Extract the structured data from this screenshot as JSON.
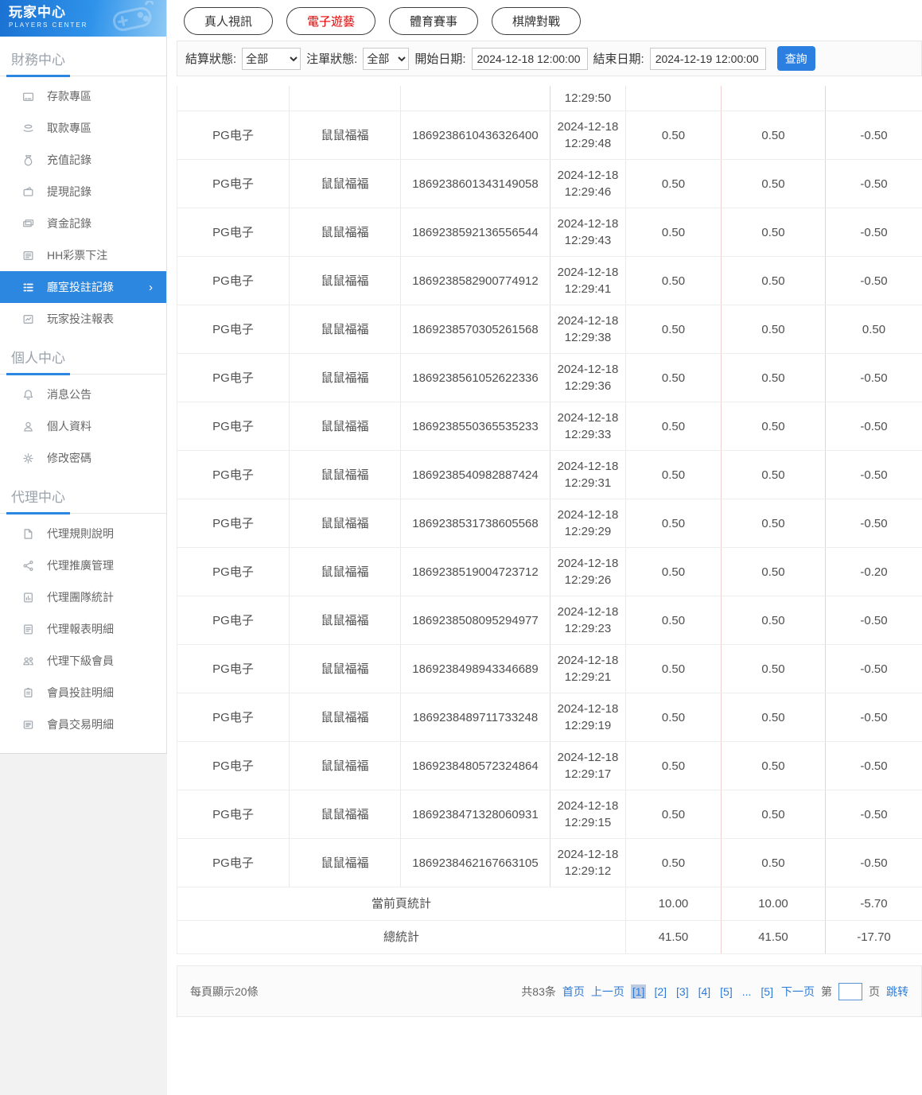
{
  "colors": {
    "sidebar_active_blue": "#2b87e0",
    "tab_active_red": "#e60000",
    "link_blue": "#2e7bd6",
    "search_button_blue": "#2b7fe0"
  },
  "sidebar": {
    "header": {
      "title": "玩家中心",
      "subtitle": "PLAYERS CENTER"
    },
    "sections": [
      {
        "title": "財務中心",
        "items": [
          {
            "icon": "deposit-card-icon",
            "label": "存款專區"
          },
          {
            "icon": "withdraw-hand-icon",
            "label": "取款專區"
          },
          {
            "icon": "recharge-record-icon",
            "label": "充值記錄"
          },
          {
            "icon": "withdrawal-record-icon",
            "label": "提現記錄"
          },
          {
            "icon": "funds-record-icon",
            "label": "資金記錄"
          },
          {
            "icon": "lottery-bet-icon",
            "label": "HH彩票下注"
          },
          {
            "icon": "room-bet-record-icon",
            "label": "廳室投註記錄",
            "active": true,
            "chevron": "›"
          },
          {
            "icon": "player-bet-report-icon",
            "label": "玩家投注報表"
          }
        ]
      },
      {
        "title": "個人中心",
        "items": [
          {
            "icon": "bell-icon",
            "label": "消息公告"
          },
          {
            "icon": "user-icon",
            "label": "個人資料"
          },
          {
            "icon": "gear-icon",
            "label": "修改密碼"
          }
        ]
      },
      {
        "title": "代理中心",
        "items": [
          {
            "icon": "rule-doc-icon",
            "label": "代理規則說明"
          },
          {
            "icon": "share-icon",
            "label": "代理推廣管理"
          },
          {
            "icon": "team-stats-icon",
            "label": "代理團隊統計"
          },
          {
            "icon": "report-detail-icon",
            "label": "代理報表明細"
          },
          {
            "icon": "sub-members-icon",
            "label": "代理下級會員"
          },
          {
            "icon": "member-bet-detail-icon",
            "label": "會員投註明細"
          },
          {
            "icon": "member-trade-detail-icon",
            "label": "會員交易明細"
          }
        ]
      }
    ]
  },
  "tabs": [
    {
      "label": "真人視訊"
    },
    {
      "label": "電子遊藝",
      "active": true
    },
    {
      "label": "體育賽事"
    },
    {
      "label": "棋牌對戰"
    }
  ],
  "filters": {
    "settle_status_label": "結算狀態:",
    "settle_status_value": "全部",
    "order_status_label": "注單狀態:",
    "order_status_value": "全部",
    "start_date_label": "開始日期:",
    "start_date_value": "2024-12-18 12:00:00",
    "end_date_label": "結束日期:",
    "end_date_value": "2024-12-19 12:00:00",
    "search_label": "查詢"
  },
  "table": {
    "rows": [
      {
        "provider": "",
        "game": "",
        "order_id": "",
        "time": "12:29:50",
        "bet": "",
        "valid": "",
        "winloss": "",
        "clipped": true
      },
      {
        "provider": "PG电子",
        "game": "鼠鼠福福",
        "order_id": "1869238610436326400",
        "time": "2024-12-18 12:29:48",
        "bet": "0.50",
        "valid": "0.50",
        "winloss": "-0.50"
      },
      {
        "provider": "PG电子",
        "game": "鼠鼠福福",
        "order_id": "1869238601343149058",
        "time": "2024-12-18 12:29:46",
        "bet": "0.50",
        "valid": "0.50",
        "winloss": "-0.50"
      },
      {
        "provider": "PG电子",
        "game": "鼠鼠福福",
        "order_id": "1869238592136556544",
        "time": "2024-12-18 12:29:43",
        "bet": "0.50",
        "valid": "0.50",
        "winloss": "-0.50"
      },
      {
        "provider": "PG电子",
        "game": "鼠鼠福福",
        "order_id": "1869238582900774912",
        "time": "2024-12-18 12:29:41",
        "bet": "0.50",
        "valid": "0.50",
        "winloss": "-0.50"
      },
      {
        "provider": "PG电子",
        "game": "鼠鼠福福",
        "order_id": "1869238570305261568",
        "time": "2024-12-18 12:29:38",
        "bet": "0.50",
        "valid": "0.50",
        "winloss": "0.50"
      },
      {
        "provider": "PG电子",
        "game": "鼠鼠福福",
        "order_id": "1869238561052622336",
        "time": "2024-12-18 12:29:36",
        "bet": "0.50",
        "valid": "0.50",
        "winloss": "-0.50"
      },
      {
        "provider": "PG电子",
        "game": "鼠鼠福福",
        "order_id": "1869238550365535233",
        "time": "2024-12-18 12:29:33",
        "bet": "0.50",
        "valid": "0.50",
        "winloss": "-0.50"
      },
      {
        "provider": "PG电子",
        "game": "鼠鼠福福",
        "order_id": "1869238540982887424",
        "time": "2024-12-18 12:29:31",
        "bet": "0.50",
        "valid": "0.50",
        "winloss": "-0.50"
      },
      {
        "provider": "PG电子",
        "game": "鼠鼠福福",
        "order_id": "1869238531738605568",
        "time": "2024-12-18 12:29:29",
        "bet": "0.50",
        "valid": "0.50",
        "winloss": "-0.50"
      },
      {
        "provider": "PG电子",
        "game": "鼠鼠福福",
        "order_id": "1869238519004723712",
        "time": "2024-12-18 12:29:26",
        "bet": "0.50",
        "valid": "0.50",
        "winloss": "-0.20"
      },
      {
        "provider": "PG电子",
        "game": "鼠鼠福福",
        "order_id": "1869238508095294977",
        "time": "2024-12-18 12:29:23",
        "bet": "0.50",
        "valid": "0.50",
        "winloss": "-0.50"
      },
      {
        "provider": "PG电子",
        "game": "鼠鼠福福",
        "order_id": "1869238498943346689",
        "time": "2024-12-18 12:29:21",
        "bet": "0.50",
        "valid": "0.50",
        "winloss": "-0.50"
      },
      {
        "provider": "PG电子",
        "game": "鼠鼠福福",
        "order_id": "1869238489711733248",
        "time": "2024-12-18 12:29:19",
        "bet": "0.50",
        "valid": "0.50",
        "winloss": "-0.50"
      },
      {
        "provider": "PG电子",
        "game": "鼠鼠福福",
        "order_id": "1869238480572324864",
        "time": "2024-12-18 12:29:17",
        "bet": "0.50",
        "valid": "0.50",
        "winloss": "-0.50"
      },
      {
        "provider": "PG电子",
        "game": "鼠鼠福福",
        "order_id": "1869238471328060931",
        "time": "2024-12-18 12:29:15",
        "bet": "0.50",
        "valid": "0.50",
        "winloss": "-0.50"
      },
      {
        "provider": "PG电子",
        "game": "鼠鼠福福",
        "order_id": "1869238462167663105",
        "time": "2024-12-18 12:29:12",
        "bet": "0.50",
        "valid": "0.50",
        "winloss": "-0.50"
      }
    ],
    "summaries": [
      {
        "label": "當前頁統計",
        "values": [
          "10.00",
          "10.00",
          "-5.70"
        ]
      },
      {
        "label": "總統計",
        "values": [
          "41.50",
          "41.50",
          "-17.70"
        ]
      }
    ]
  },
  "footer": {
    "page_size_label": "每頁顯示20條",
    "pagination": {
      "total": "共83条",
      "first": "首页",
      "prev": "上一页",
      "pages": [
        {
          "label": "[1]",
          "current": true
        },
        {
          "label": "[2]"
        },
        {
          "label": "[3]"
        },
        {
          "label": "[4]"
        },
        {
          "label": "[5]"
        },
        {
          "label": "..."
        },
        {
          "label": "[5]"
        }
      ],
      "next": "下一页",
      "jump_prefix": "第",
      "jump_suffix": "页",
      "jump_button": "跳转"
    }
  }
}
